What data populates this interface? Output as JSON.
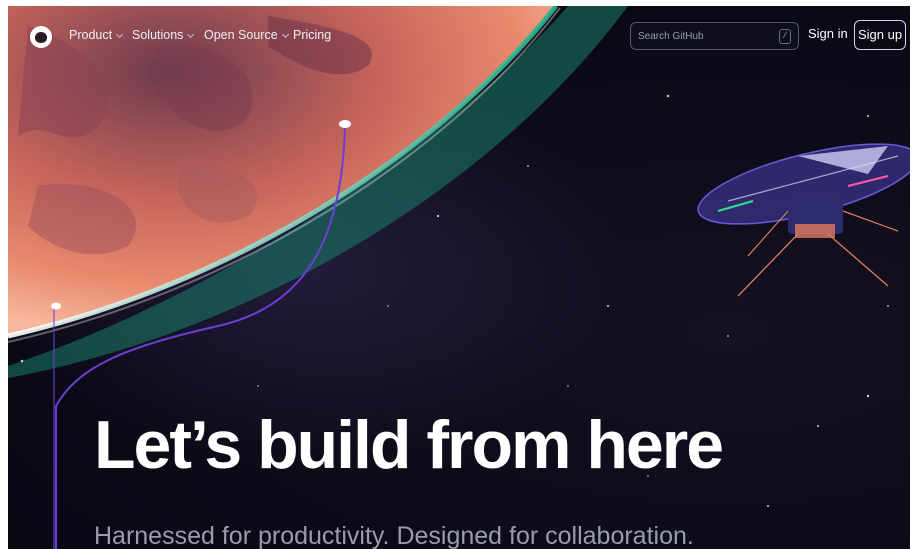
{
  "nav": {
    "items": [
      {
        "label": "Product",
        "dropdown": true
      },
      {
        "label": "Solutions",
        "dropdown": true
      },
      {
        "label": "Open Source",
        "dropdown": true
      },
      {
        "label": "Pricing",
        "dropdown": false
      }
    ],
    "search_placeholder": "Search GitHub",
    "search_shortcut": "/",
    "sign_in": "Sign in",
    "sign_up": "Sign up"
  },
  "hero": {
    "headline": "Let’s build from here",
    "subhead": "Harnessed for productivity. Designed for collaboration."
  },
  "colors": {
    "background": "#0b0a16",
    "planet": "#e07a5f",
    "horizon_glow": "#20b28a",
    "trail": "#6b3fd6"
  },
  "icons": [
    "github-logo",
    "chevron-down-icon",
    "helicopter-illustration",
    "planet-illustration"
  ]
}
